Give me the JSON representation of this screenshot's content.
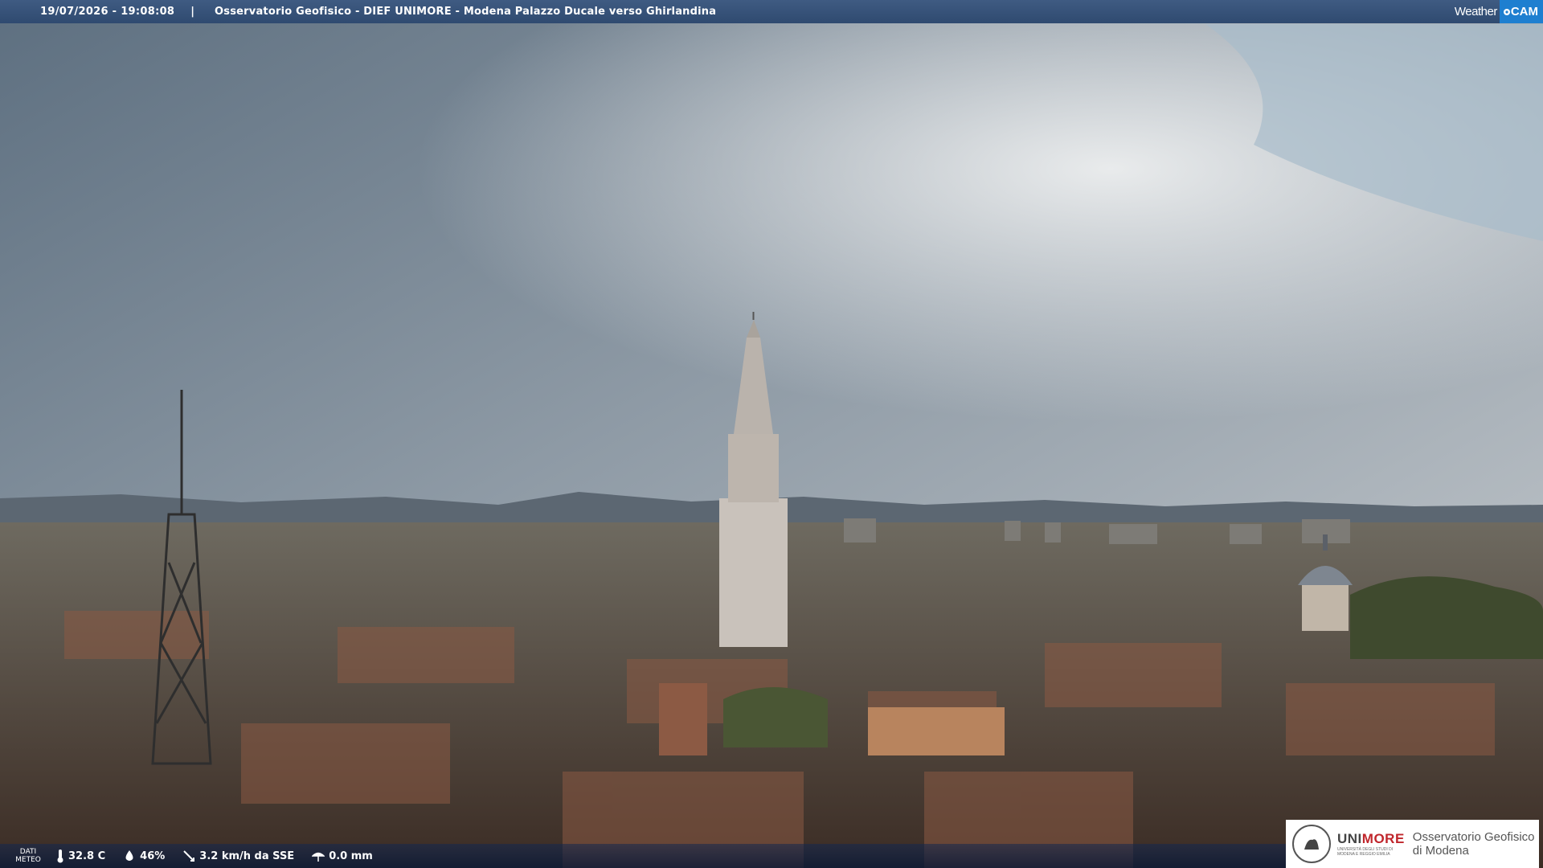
{
  "overlay": {
    "timestamp": "19/07/2026 - 19:08:08",
    "separator": "|",
    "title": "Osservatorio Geofisico - DIEF UNIMORE - Modena Palazzo Ducale verso Ghirlandina",
    "brand_weather": "Weather",
    "brand_cam": "CAM"
  },
  "weather": {
    "label_line1": "DATI",
    "label_line2": "METEO",
    "temperature": "32.8 C",
    "humidity": "46%",
    "wind": "3.2 km/h da SSE",
    "rain": "0.0 mm"
  },
  "logo": {
    "uni": "UNI",
    "more": "MORE",
    "subtitle_line1": "UNIVERSITÀ DEGLI STUDI DI",
    "subtitle_line2": "MODENA E REGGIO EMILIA",
    "observatory_line1": "Osservatorio Geofisico",
    "observatory_line2": "di Modena"
  },
  "colors": {
    "bar": "#2f4a70",
    "brand_accent": "#1e7fd0",
    "unimore_red": "#c0262c"
  }
}
